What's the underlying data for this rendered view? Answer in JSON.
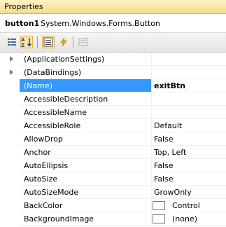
{
  "window": {
    "title": "Properties"
  },
  "object": {
    "name": "button1",
    "type": "System.Windows.Forms.Button"
  },
  "toolbar": {
    "icons": [
      "categorized-icon",
      "alphabetical-icon",
      "properties-icon",
      "events-icon",
      "property-pages-icon"
    ],
    "active": "alphabetical"
  },
  "colors": {
    "title_bar": "#f5dc8a",
    "selection": "#3399ff"
  },
  "properties": [
    {
      "name": "(ApplicationSettings)",
      "value": "",
      "expandable": true
    },
    {
      "name": "(DataBindings)",
      "value": "",
      "expandable": true
    },
    {
      "name": "(Name)",
      "value": "exitBtn",
      "selected": true
    },
    {
      "name": "AccessibleDescription",
      "value": ""
    },
    {
      "name": "AccessibleName",
      "value": ""
    },
    {
      "name": "AccessibleRole",
      "value": "Default"
    },
    {
      "name": "AllowDrop",
      "value": "False"
    },
    {
      "name": "Anchor",
      "value": "Top, Left"
    },
    {
      "name": "AutoEllipsis",
      "value": "False"
    },
    {
      "name": "AutoSize",
      "value": "False"
    },
    {
      "name": "AutoSizeMode",
      "value": "GrowOnly"
    },
    {
      "name": "BackColor",
      "value": "Control",
      "swatch": true
    },
    {
      "name": "BackgroundImage",
      "value": "(none)",
      "swatch": true
    }
  ]
}
